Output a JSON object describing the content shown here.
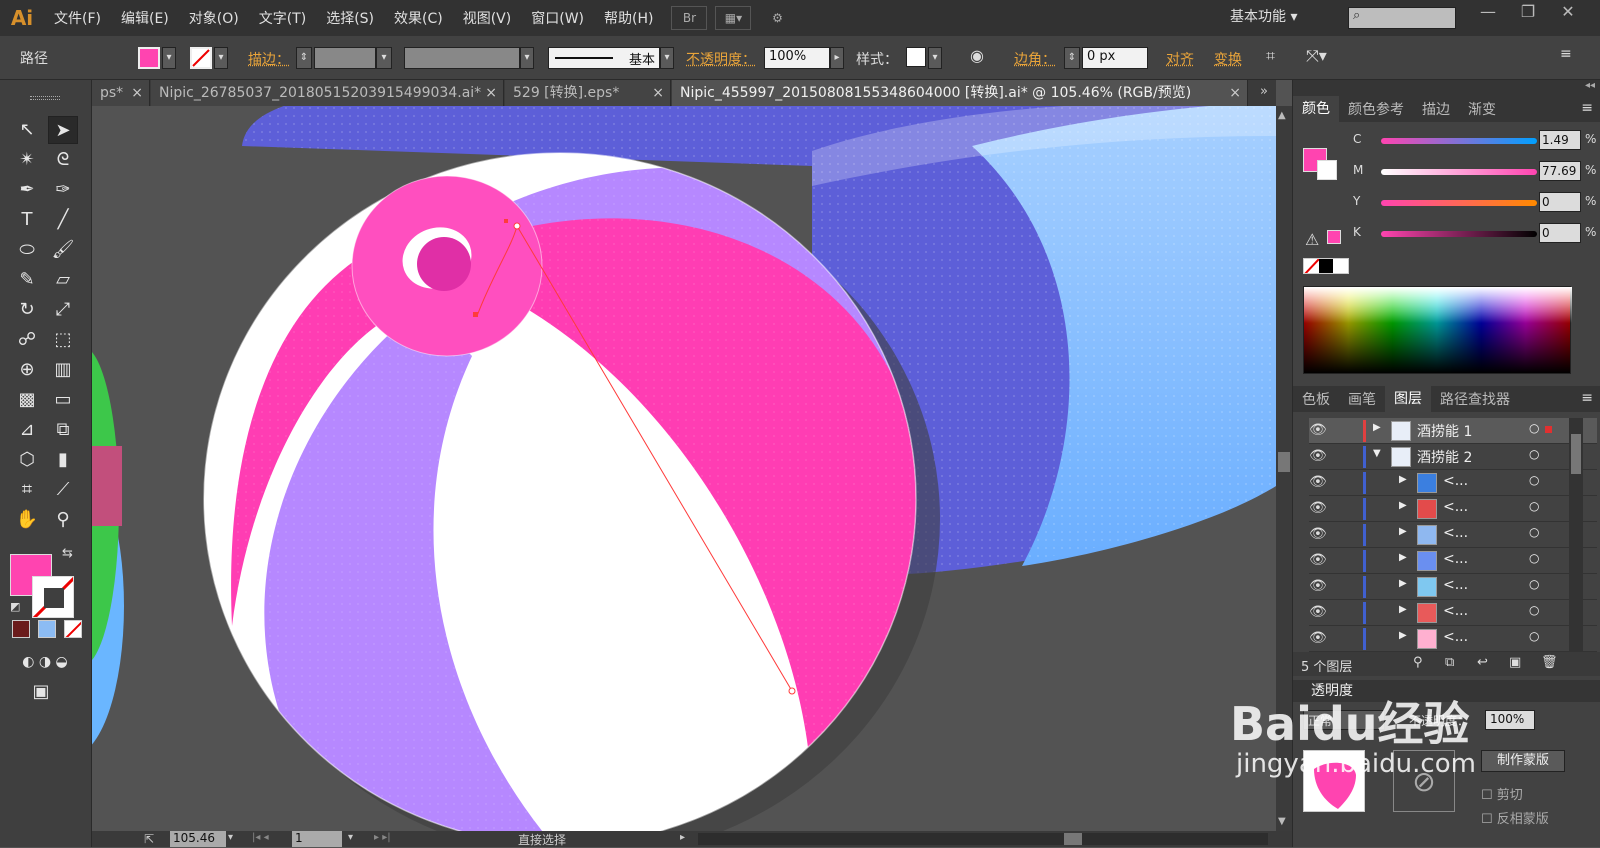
{
  "app": {
    "logo": "Ai"
  },
  "menu": [
    "文件(F)",
    "编辑(E)",
    "对象(O)",
    "文字(T)",
    "选择(S)",
    "效果(C)",
    "视图(V)",
    "窗口(W)",
    "帮助(H)"
  ],
  "menubar": {
    "br_label": "Br",
    "workspace": "基本功能"
  },
  "control": {
    "object_type": "路径",
    "stroke_label": "描边：",
    "stroke_style": "基本",
    "opacity_label": "不透明度：",
    "opacity_value": "100%",
    "style_label": "样式：",
    "corner_label": "边角：",
    "corner_value": "0 px",
    "align_label": "对齐",
    "transform_label": "变换"
  },
  "tabs": [
    {
      "title": "ps*"
    },
    {
      "title": "Nipic_26785037_20180515203915499034.ai*"
    },
    {
      "title": "529 [转换].eps*"
    },
    {
      "title": "Nipic_455997_20150808155348604000 [转换].ai* @ 105.46% (RGB/预览)"
    }
  ],
  "color_panel": {
    "tabs": [
      "颜色",
      "颜色参考",
      "描边",
      "渐变"
    ],
    "channels": [
      {
        "label": "C",
        "value": "1.49"
      },
      {
        "label": "M",
        "value": "77.69"
      },
      {
        "label": "Y",
        "value": "0"
      },
      {
        "label": "K",
        "value": "0"
      }
    ],
    "percent": "%"
  },
  "layers_panel": {
    "tabs": [
      "色板",
      "画笔",
      "图层",
      "路径查找器"
    ],
    "layers": [
      {
        "name": "酒捞能 1"
      },
      {
        "name": "酒捞能 2"
      },
      {
        "name": "<..."
      },
      {
        "name": "<..."
      },
      {
        "name": "<..."
      },
      {
        "name": "<..."
      },
      {
        "name": "<..."
      },
      {
        "name": "<..."
      },
      {
        "name": "<..."
      }
    ],
    "count": "5 个图层"
  },
  "transparency_panel": {
    "title": "透明度",
    "mode": "正常",
    "opacity_label": "不透明度：",
    "opacity_value": "100%",
    "make_mask": "制作蒙版",
    "clip": "剪切",
    "invert": "反相蒙版"
  },
  "status": {
    "zoom": "105.46",
    "artboard": "1",
    "tool": "直接选择"
  },
  "watermark": {
    "brand": "Baidu经验",
    "url": "jingyan.baidu.com"
  },
  "colors": {
    "fill": "#ff44b0",
    "accent": "#e9a43a"
  }
}
